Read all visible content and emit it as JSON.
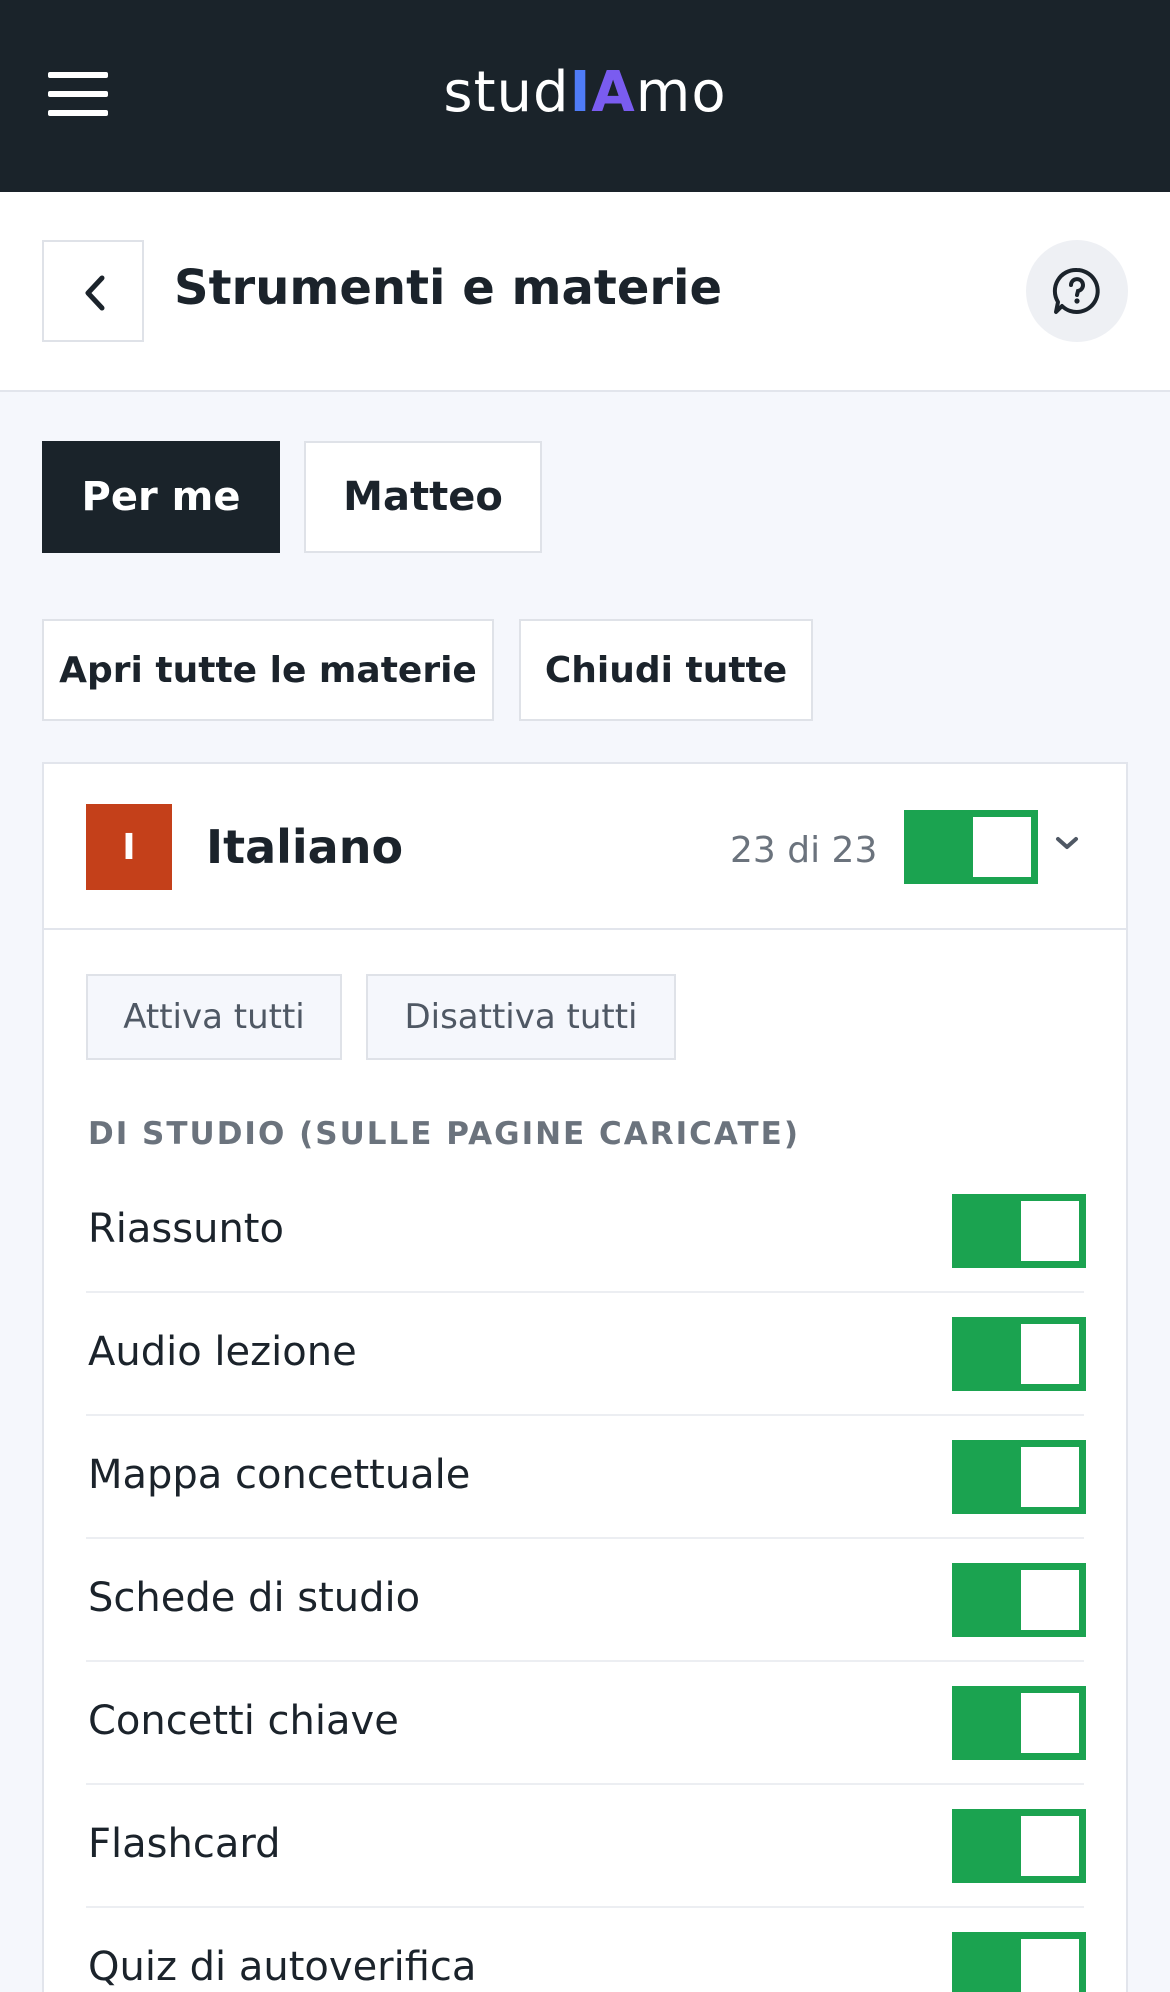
{
  "app": {
    "logo_prefix": "stud",
    "logo_ai_1": "I",
    "logo_ai_2": "A",
    "logo_suffix": "mo"
  },
  "header": {
    "title": "Strumenti e materie"
  },
  "tabs": [
    {
      "label": "Per me",
      "active": true
    },
    {
      "label": "Matteo",
      "active": false
    }
  ],
  "actions": {
    "open_all": "Apri tutte le materie",
    "close_all": "Chiudi tutte"
  },
  "subject": {
    "badge": "I",
    "badge_color": "#c4401a",
    "name": "Italiano",
    "count": "23 di 23",
    "enabled": true,
    "activate_all": "Attiva tutti",
    "deactivate_all": "Disattiva tutti",
    "section_label": "DI STUDIO (SULLE PAGINE CARICATE)",
    "tools": [
      {
        "label": "Riassunto",
        "enabled": true
      },
      {
        "label": "Audio lezione",
        "enabled": true
      },
      {
        "label": "Mappa concettuale",
        "enabled": true
      },
      {
        "label": "Schede di studio",
        "enabled": true
      },
      {
        "label": "Concetti chiave",
        "enabled": true
      },
      {
        "label": "Flashcard",
        "enabled": true
      },
      {
        "label": "Quiz di autoverifica",
        "enabled": true
      }
    ]
  },
  "colors": {
    "topbar": "#1a232a",
    "toggle_on": "#1ba350"
  },
  "icons": {
    "menu": "hamburger-menu-icon",
    "back": "chevron-left-icon",
    "help": "help-chat-icon",
    "expand": "chevron-down-icon"
  }
}
